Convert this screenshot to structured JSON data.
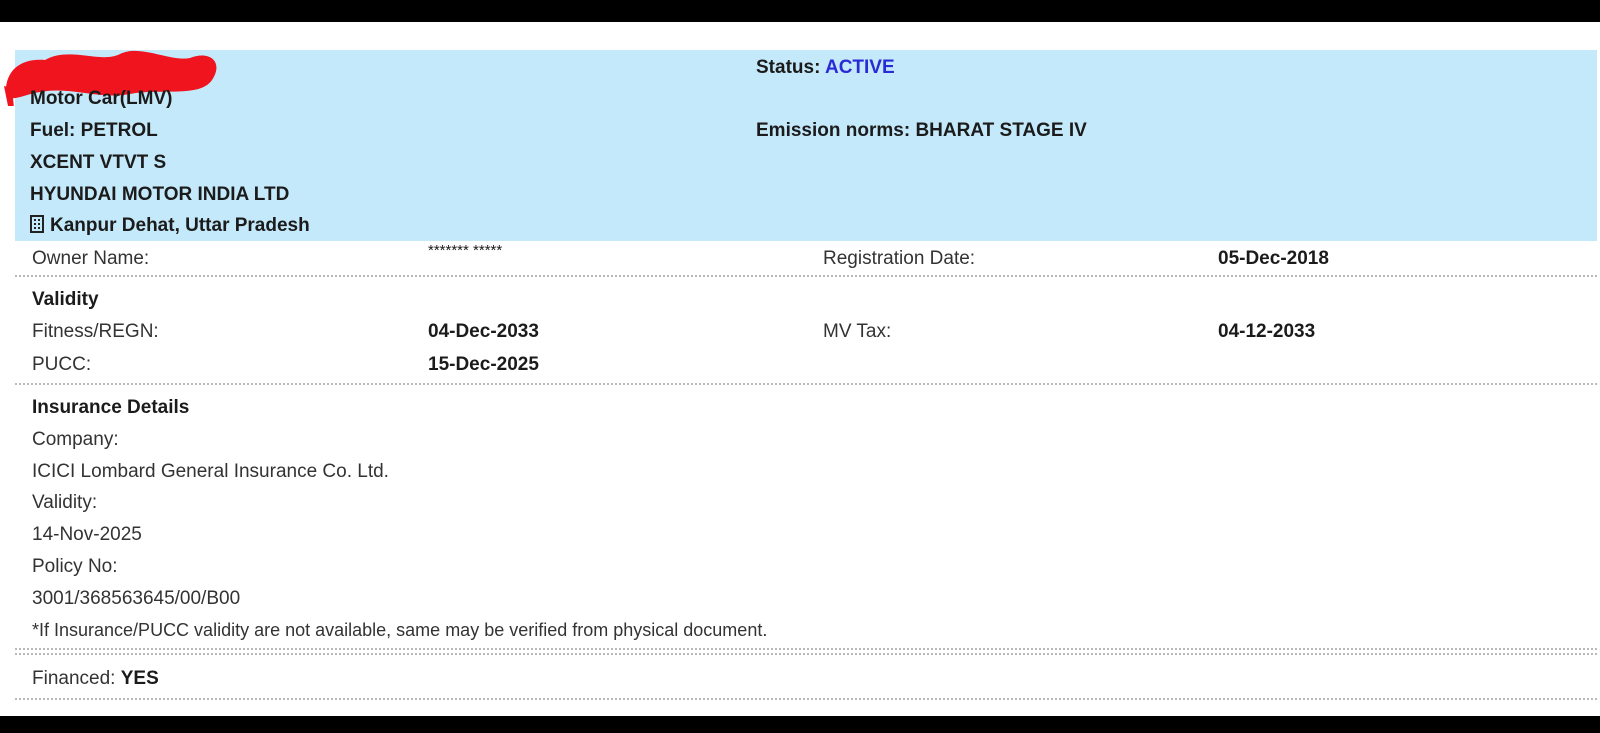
{
  "header": {
    "vehicle_class": "Motor Car(LMV)",
    "fuel_label": "Fuel:",
    "fuel_value": "PETROL",
    "model": "XCENT VTVT S",
    "maker": "HYUNDAI MOTOR INDIA LTD",
    "location_icon": "building-icon",
    "location": "Kanpur Dehat, Uttar Pradesh",
    "status_label": "Status:",
    "status_value": "ACTIVE",
    "emission_label": "Emission norms:",
    "emission_value": "BHARAT STAGE IV"
  },
  "owner": {
    "owner_label": "Owner Name:",
    "owner_value": "******* *****",
    "reg_date_label": "Registration Date:",
    "reg_date_value": "05-Dec-2018"
  },
  "validity": {
    "title": "Validity",
    "fitness_label": "Fitness/REGN:",
    "fitness_value": "04-Dec-2033",
    "mvtax_label": "MV Tax:",
    "mvtax_value": "04-12-2033",
    "pucc_label": "PUCC:",
    "pucc_value": "15-Dec-2025"
  },
  "insurance": {
    "title": "Insurance Details",
    "company_label": "Company:",
    "company_value": "ICICI Lombard General Insurance Co. Ltd.",
    "validity_label": "Validity:",
    "validity_value": "14-Nov-2025",
    "policy_label": "Policy No:",
    "policy_value": "3001/368563645/00/B00",
    "note": "*If Insurance/PUCC validity are not available, same may be verified from physical document."
  },
  "finance": {
    "label": "Financed:",
    "value": "YES"
  },
  "colors": {
    "header_bg": "#c4e9fa",
    "link_blue": "#2a2ad6",
    "redaction_red": "#f0141e"
  }
}
